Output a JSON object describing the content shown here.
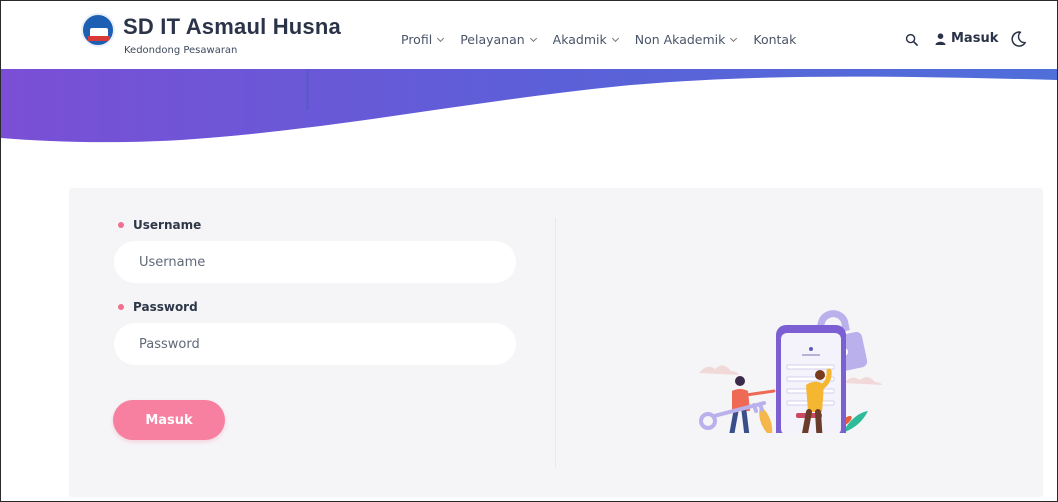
{
  "brand": {
    "title": "SD IT Asmaul Husna",
    "subtitle": "Kedondong Pesawaran"
  },
  "nav": {
    "items": [
      {
        "label": "Profil",
        "dropdown": true
      },
      {
        "label": "Pelayanan",
        "dropdown": true
      },
      {
        "label": "Akadmik",
        "dropdown": true
      },
      {
        "label": "Non Akademik",
        "dropdown": true
      },
      {
        "label": "Kontak",
        "dropdown": false
      }
    ],
    "login_label": "Masuk",
    "icons": [
      "search-icon",
      "user-icon",
      "moon-icon"
    ]
  },
  "form": {
    "username_label": "Username",
    "username_placeholder": "Username",
    "password_label": "Password",
    "password_placeholder": "Password",
    "submit_label": "Masuk"
  },
  "colors": {
    "accent_pink": "#f77fa0",
    "hero_start": "#7a4fd6",
    "hero_end": "#4f6fd9",
    "brand_blue": "#1d5fb3"
  }
}
